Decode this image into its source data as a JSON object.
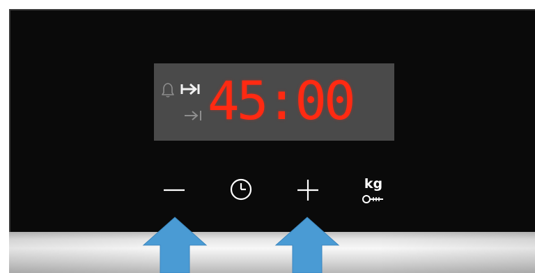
{
  "display": {
    "time": "45:00",
    "active_indicator": "duration-icon",
    "indicator_color": "#ff2a12"
  },
  "controls": {
    "minus": {
      "icon": "minus-icon"
    },
    "clock": {
      "icon": "clock-icon"
    },
    "plus": {
      "icon": "plus-icon"
    },
    "weight": {
      "label": "kg",
      "icon": "meat-probe-icon"
    }
  },
  "icons": {
    "alarm": "bell-icon",
    "duration": "duration-arrow-icon",
    "end_time": "end-time-arrow-icon"
  },
  "arrows": [
    "pointer-arrow-minus",
    "pointer-arrow-plus"
  ],
  "colors": {
    "panel": "#0a0a0a",
    "display_bg": "#4a4a4a",
    "digits": "#ff2a12",
    "arrow": "#4a9bd4"
  }
}
